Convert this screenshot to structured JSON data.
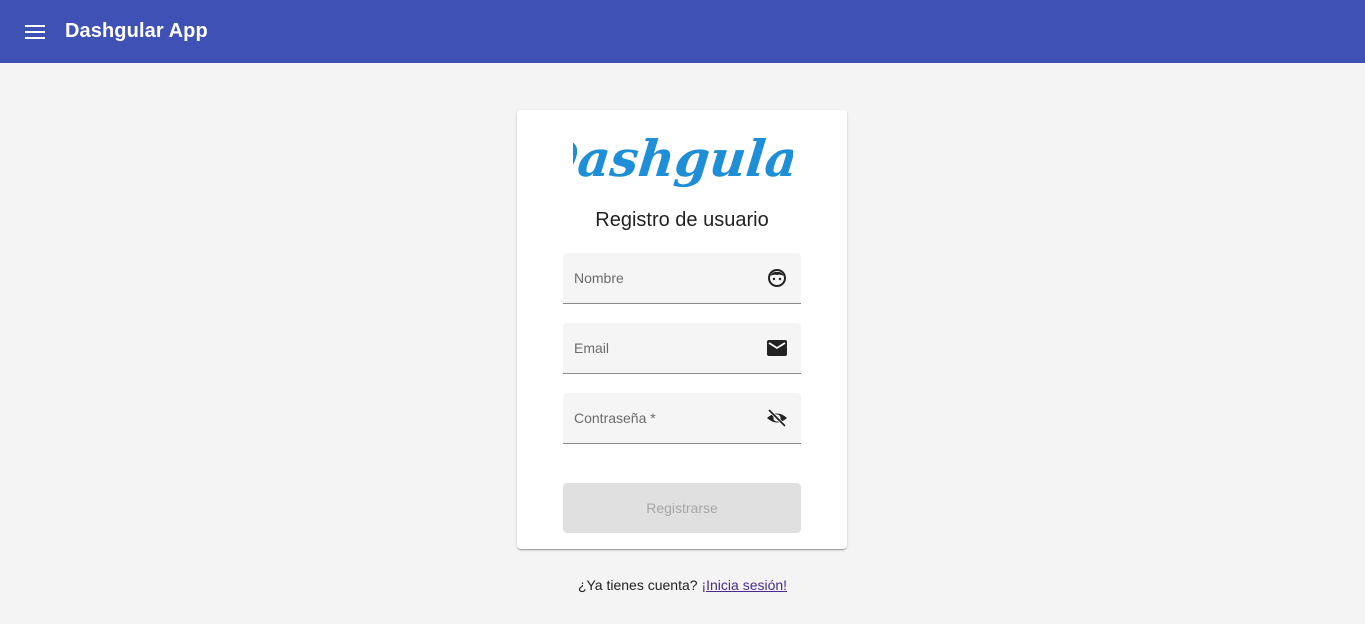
{
  "header": {
    "menu_icon": "menu-icon",
    "title": "Dashgular App",
    "color": "#3f51b5"
  },
  "card": {
    "logo_text": "Dashgular",
    "logo_color": "#1e8fd6",
    "title": "Registro de usuario",
    "fields": [
      {
        "placeholder": "Nombre",
        "icon": "face-icon"
      },
      {
        "placeholder": "Email",
        "icon": "mail-icon"
      },
      {
        "placeholder": "Contraseña *",
        "icon": "visibility-off-icon"
      }
    ],
    "submit_label": "Registrarse",
    "submit_disabled": true
  },
  "footer": {
    "prompt": "¿Ya tienes cuenta?",
    "link": "¡Inicia sesión!"
  }
}
